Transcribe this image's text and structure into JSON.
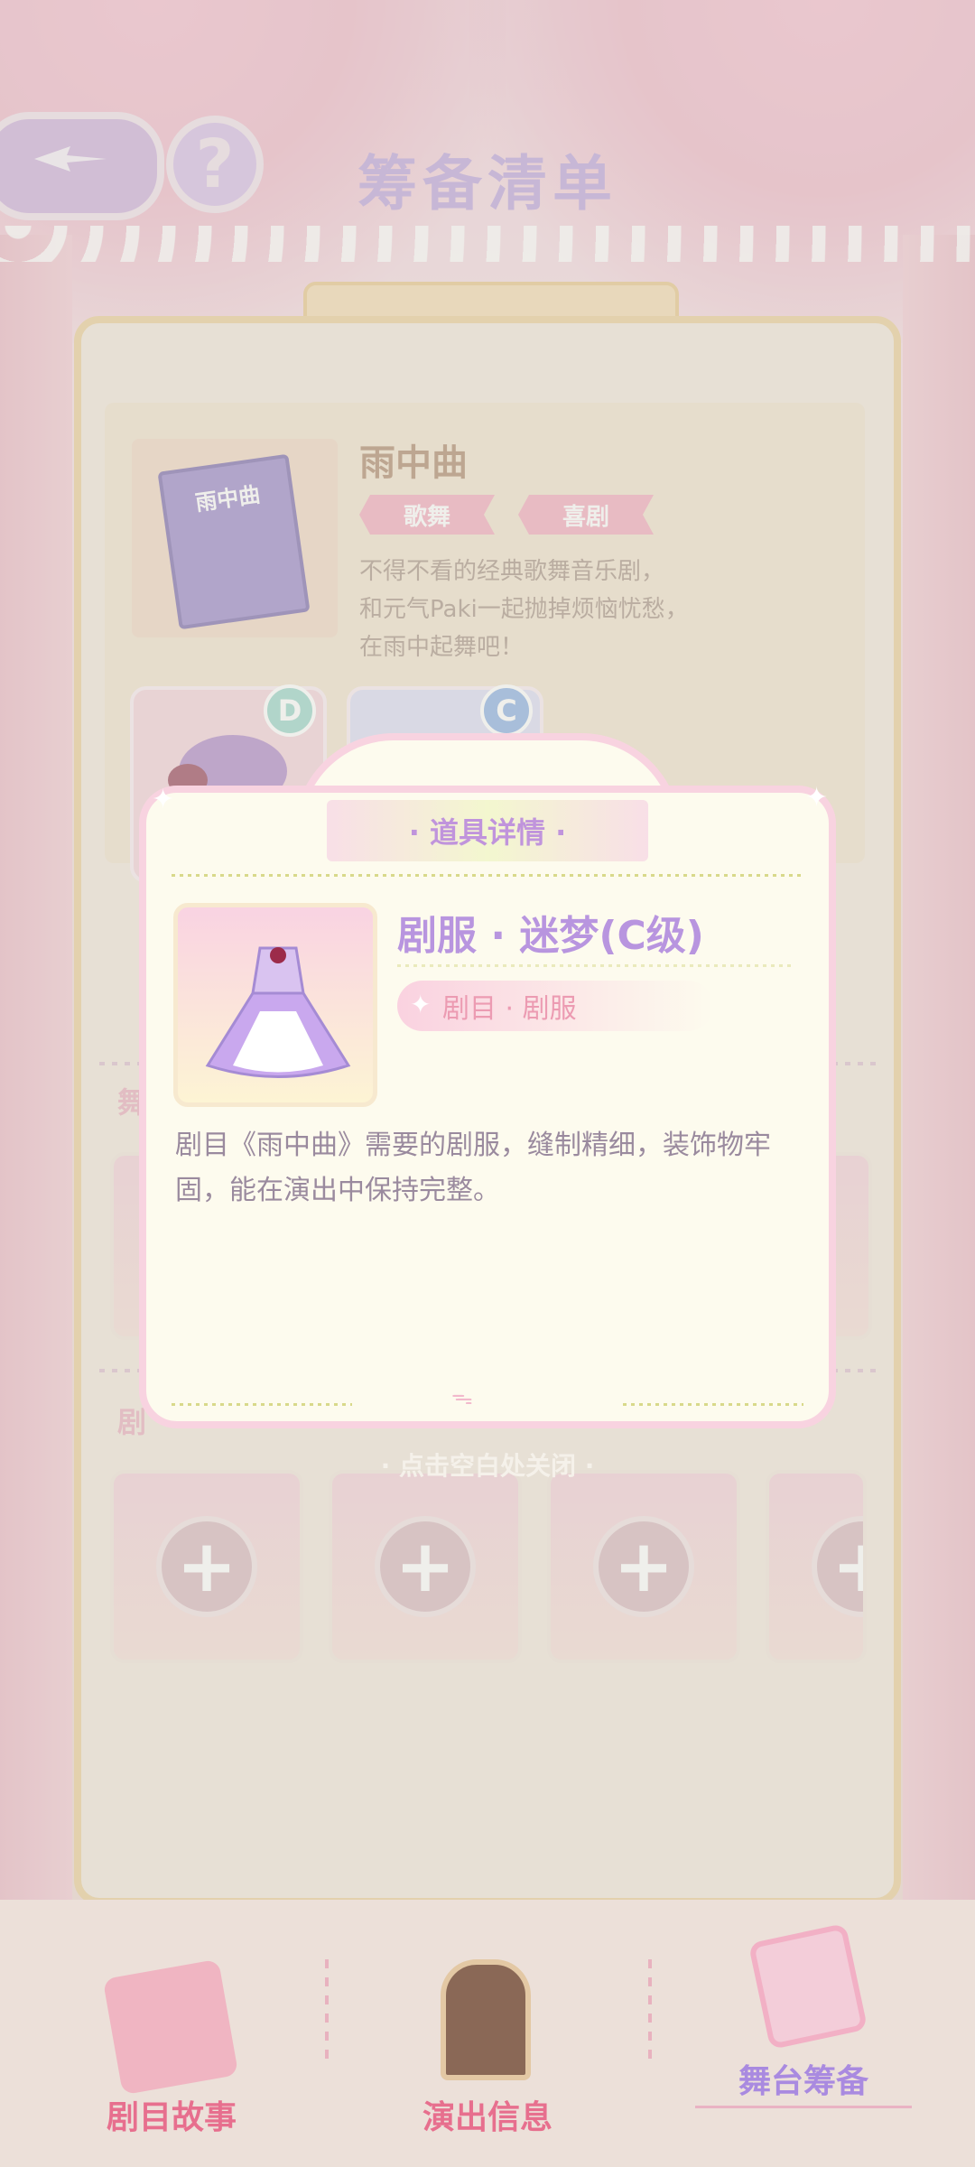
{
  "header": {
    "title": "筹备清单",
    "help_label": "?"
  },
  "show": {
    "book_cover_text": "雨中曲",
    "title": "雨中曲",
    "tags": [
      "歌舞",
      "喜剧"
    ],
    "description_lines": [
      "不得不看的经典歌舞音乐剧，",
      "和元气Paki一起抛掉烦恼忧愁，",
      "在雨中起舞吧！"
    ],
    "items": [
      {
        "grade": "D",
        "badge_color": "#8fcfc3"
      },
      {
        "grade": "C",
        "badge_color": "#7ea6e0"
      }
    ]
  },
  "sections": {
    "upper_label": "舞",
    "lower_label": "剧"
  },
  "slots": {
    "plus_symbol": "+",
    "count": 4
  },
  "modal": {
    "header": "· 道具详情 ·",
    "item_name": "剧服 · 迷梦(C级)",
    "item_type": "剧目 · 剧服",
    "description": "剧目《雨中曲》需要的剧服，缝制精细，装饰物牢固，能在演出中保持完整。",
    "close_hint": "· 点击空白处关闭 ·"
  },
  "nav": {
    "items": [
      {
        "label": "剧目故事",
        "color": "#e76f8e",
        "icon": "book-icon"
      },
      {
        "label": "演出信息",
        "color": "#e76f8e",
        "icon": "info-board-icon"
      },
      {
        "label": "舞台筹备",
        "color": "#a98ae0",
        "icon": "checklist-icon",
        "active": true
      }
    ]
  },
  "colors": {
    "accent_purple": "#b895df",
    "accent_pink": "#f2a0b6",
    "board_border": "#e9c98f"
  }
}
